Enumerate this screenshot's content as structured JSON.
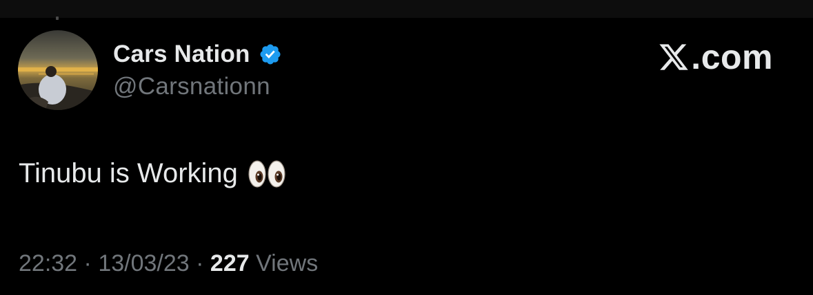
{
  "post": {
    "display_name": "Cars Nation",
    "handle": "@Carsnationn",
    "verified_icon": "verified-badge-icon",
    "text": "Tinubu is Working",
    "emoji": "👀",
    "time": "22:32",
    "separator": "·",
    "date": "13/03/23",
    "views_count": "227",
    "views_label": "Views"
  },
  "brand": {
    "text": ".com",
    "icon": "x-logo-icon"
  },
  "colors": {
    "background": "#000000",
    "primary_text": "#e7e9ea",
    "secondary_text": "#71767b",
    "verified_blue": "#1d9bf0"
  }
}
